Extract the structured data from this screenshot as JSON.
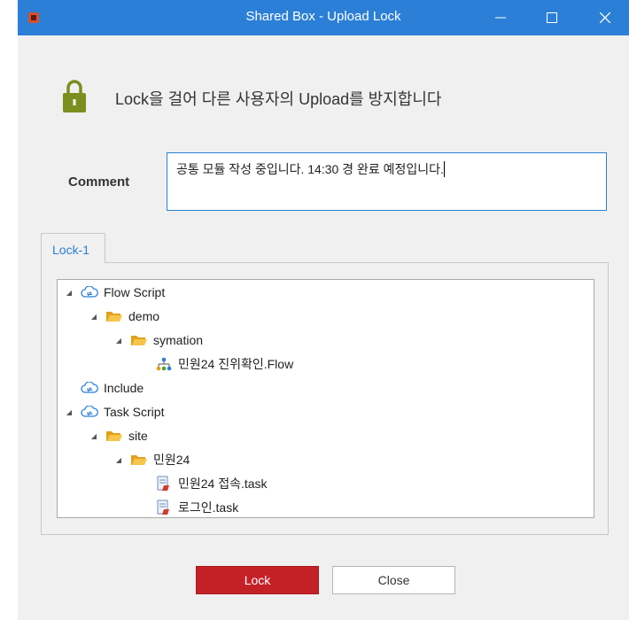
{
  "window": {
    "title": "Shared Box - Upload Lock"
  },
  "header": {
    "message": "Lock을 걸어 다른 사용자의 Upload를 방지합니다"
  },
  "comment": {
    "label": "Comment",
    "value": "공통 모듈 작성 중입니다. 14:30 경 완료 예정입니다."
  },
  "tabs": [
    {
      "label": "Lock-1",
      "active": true
    }
  ],
  "tree": {
    "nodes": [
      {
        "label": "Flow Script",
        "icon": "cloud-sync-icon",
        "expanded": true
      },
      {
        "label": "demo",
        "icon": "folder-open-icon",
        "expanded": true
      },
      {
        "label": "symation",
        "icon": "folder-open-icon",
        "expanded": true
      },
      {
        "label": "민원24 진위확인.Flow",
        "icon": "flow-file-icon"
      },
      {
        "label": "Include",
        "icon": "cloud-sync-icon"
      },
      {
        "label": "Task Script",
        "icon": "cloud-sync-icon",
        "expanded": true
      },
      {
        "label": "site",
        "icon": "folder-open-icon",
        "expanded": true
      },
      {
        "label": "민원24",
        "icon": "folder-open-icon",
        "expanded": true
      },
      {
        "label": "민원24 접속.task",
        "icon": "task-file-icon"
      },
      {
        "label": "로그인.task",
        "icon": "task-file-icon"
      }
    ]
  },
  "buttons": {
    "lock": "Lock",
    "close": "Close"
  },
  "colors": {
    "titlebar": "#2b7fd6",
    "lock_button": "#c42127",
    "lock_icon": "#7a8f1e",
    "folder": "#f0b429",
    "accent": "#2b7fd6"
  }
}
